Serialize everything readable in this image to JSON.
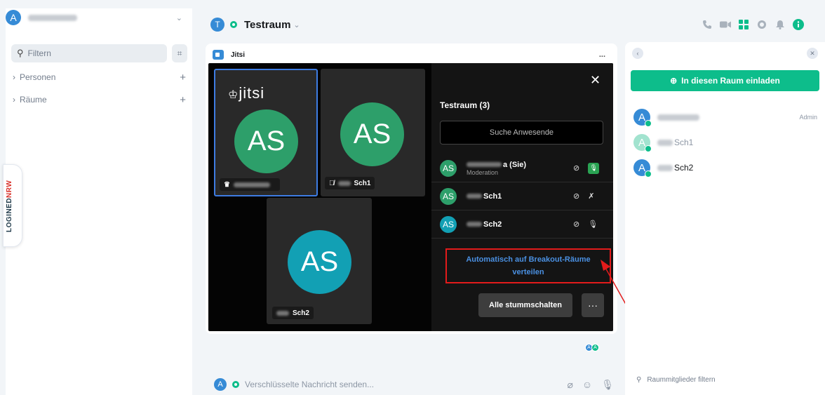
{
  "sidebar": {
    "filter_placeholder": "Filtern",
    "sections": [
      {
        "label": "Personen"
      },
      {
        "label": "Räume"
      }
    ],
    "user_avatar_letter": "A",
    "logined_brand": "LOGINEDNRW"
  },
  "header": {
    "room_avatar_letter": "T",
    "room_name": "Testraum",
    "icons": [
      "phone-icon",
      "video-icon",
      "apps-icon",
      "threads-icon",
      "bell-icon",
      "info-icon"
    ]
  },
  "widget": {
    "title": "Jitsi",
    "menu": "...",
    "logo_text": "jitsi",
    "tiles": [
      {
        "initials": "AS",
        "name_suffix": "",
        "color": "#2d9f6a"
      },
      {
        "initials": "AS",
        "name_suffix": "Sch1",
        "color": "#2d9f6a"
      },
      {
        "initials": "AS",
        "name_suffix": "Sch2",
        "color": "#12a0b4"
      }
    ]
  },
  "participants_pane": {
    "title": "Testraum (3)",
    "search_placeholder": "Suche Anwesende",
    "participants": [
      {
        "initials": "AS",
        "name_suffix": "a (Sie)",
        "role": "Moderation",
        "color": "#2d9f6a"
      },
      {
        "initials": "AS",
        "name_suffix": "Sch1",
        "role": "",
        "color": "#2d9f6a"
      },
      {
        "initials": "AS",
        "name_suffix": "Sch2",
        "role": "",
        "color": "#12a0b4"
      }
    ],
    "breakout_label_1": "Automatisch auf Breakout-Räume",
    "breakout_label_2": "verteilen",
    "mute_all": "Alle stummschalten",
    "more": "···"
  },
  "composer": {
    "avatar_letter": "A",
    "placeholder": "Verschlüsselte Nachricht senden..."
  },
  "right_panel": {
    "invite_label": "In diesen Raum einladen",
    "members": [
      {
        "letter": "A",
        "name": "",
        "role": "Admin",
        "color": "#368bd6"
      },
      {
        "letter": "A",
        "name": "Sch1",
        "role": "",
        "color": "#a2e3cf"
      },
      {
        "letter": "A",
        "name": "Sch2",
        "role": "",
        "color": "#368bd6"
      }
    ],
    "filter_placeholder": "Raummitglieder filtern"
  },
  "colors": {
    "accent": "#0dbd8b",
    "highlight": "#e31b1b",
    "link": "#4a90e2"
  }
}
